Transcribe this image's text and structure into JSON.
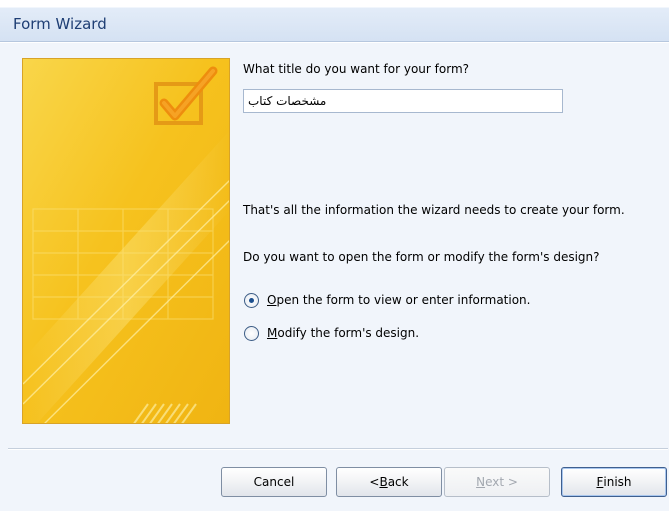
{
  "window": {
    "title": "Form Wizard"
  },
  "prompt": {
    "title_question": "What title do you want for your form?",
    "title_value": "مشخصات کتاب",
    "info_text": "That's all the information the wizard needs to create your form.",
    "open_or_modify_question": "Do you want to open the form or modify the form's design?"
  },
  "options": {
    "open_form": {
      "label_prefix": "",
      "accel": "O",
      "label_rest": "pen the form to view or enter information.",
      "checked": true
    },
    "modify_design": {
      "label_prefix": "",
      "accel": "M",
      "label_rest": "odify the form's design.",
      "checked": false
    }
  },
  "buttons": {
    "cancel": {
      "label": "Cancel",
      "enabled": true
    },
    "back": {
      "prefix": "< ",
      "accel": "B",
      "rest": "ack",
      "enabled": true
    },
    "next": {
      "accel": "N",
      "rest": "ext >",
      "enabled": false
    },
    "finish": {
      "accel": "F",
      "rest": "inish",
      "enabled": true
    }
  },
  "colors": {
    "titlebar_text": "#1e3e74",
    "art_yellow": "#f7c51a",
    "art_border": "#d8a327"
  },
  "icons": {
    "wizard_art": "checkmark-box-icon"
  }
}
